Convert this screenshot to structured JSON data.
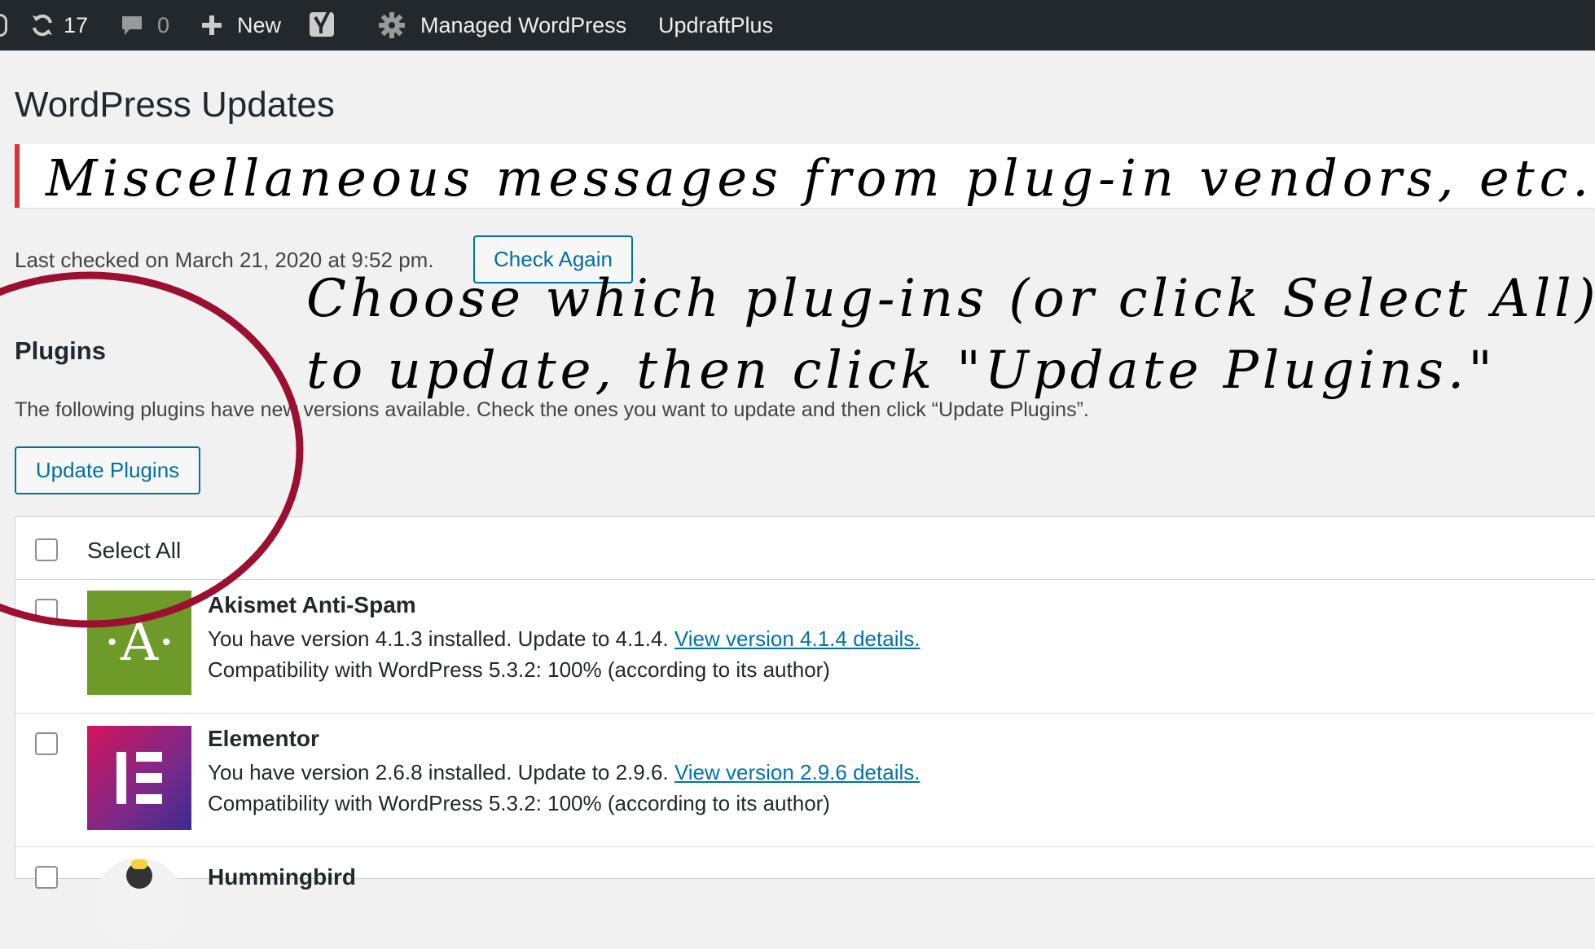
{
  "admin_bar": {
    "updates_count": "17",
    "comments_count": "0",
    "new_label": "New",
    "managed_wp_label": "Managed WordPress",
    "updraft_label": "UpdraftPlus"
  },
  "page": {
    "title": "WordPress Updates",
    "last_checked": "Last checked on March 21, 2020 at 9:52 pm.",
    "check_again_label": "Check Again"
  },
  "plugins_section": {
    "title": "Plugins",
    "description": "The following plugins have new versions available. Check the ones you want to update and then click “Update Plugins”.",
    "update_button_label": "Update Plugins",
    "select_all_label": "Select All",
    "items": [
      {
        "name": "Akismet Anti-Spam",
        "update_text": "You have version 4.1.3 installed. Update to 4.1.4.",
        "details_link": "View version 4.1.4 details.",
        "compat": "Compatibility with WordPress 5.3.2: 100% (according to its author)",
        "icon_letter": "·A·"
      },
      {
        "name": "Elementor",
        "update_text": "You have version 2.6.8 installed. Update to 2.9.6.",
        "details_link": "View version 2.9.6 details.",
        "compat": "Compatibility with WordPress 5.3.2: 100% (according to its author)"
      },
      {
        "name": "Hummingbird"
      }
    ]
  },
  "annotations": {
    "notice_note": "Miscellaneous messages from plug-in vendors, etc.",
    "instruction_line1": "Choose which plug-ins (or click Select All)",
    "instruction_line2": "to update, then click \"Update Plugins.\""
  },
  "colors": {
    "admin_bar": "#23282d",
    "link": "#0073aa",
    "button_border": "#0071a1",
    "notice_border": "#dc3232",
    "annotation_circle": "#9b1030",
    "akismet_green": "#6e9a2a",
    "elementor_start": "#d2145a",
    "elementor_end": "#3c2a8f"
  },
  "icons": [
    "wordpress-logo-icon",
    "refresh-icon",
    "comment-icon",
    "plus-icon",
    "yoast-icon",
    "gear-icon"
  ]
}
